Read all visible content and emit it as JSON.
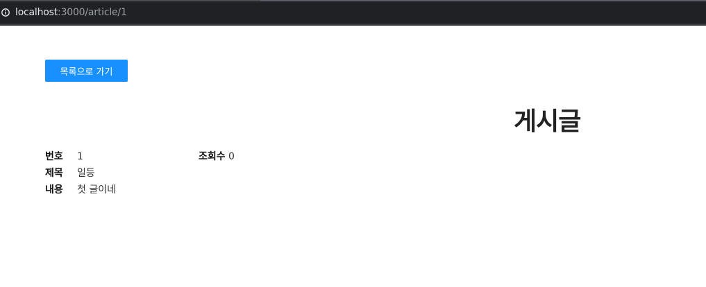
{
  "browser": {
    "url_host": "localhost",
    "url_path": ":3000/article/1"
  },
  "page": {
    "back_button_label": "목록으로 가기",
    "title": "게시글"
  },
  "article": {
    "number_label": "번호",
    "number_value": "1",
    "views_label": "조회수",
    "views_value": "0",
    "title_label": "제목",
    "title_value": "일등",
    "content_label": "내용",
    "content_value": "첫 글이네"
  }
}
